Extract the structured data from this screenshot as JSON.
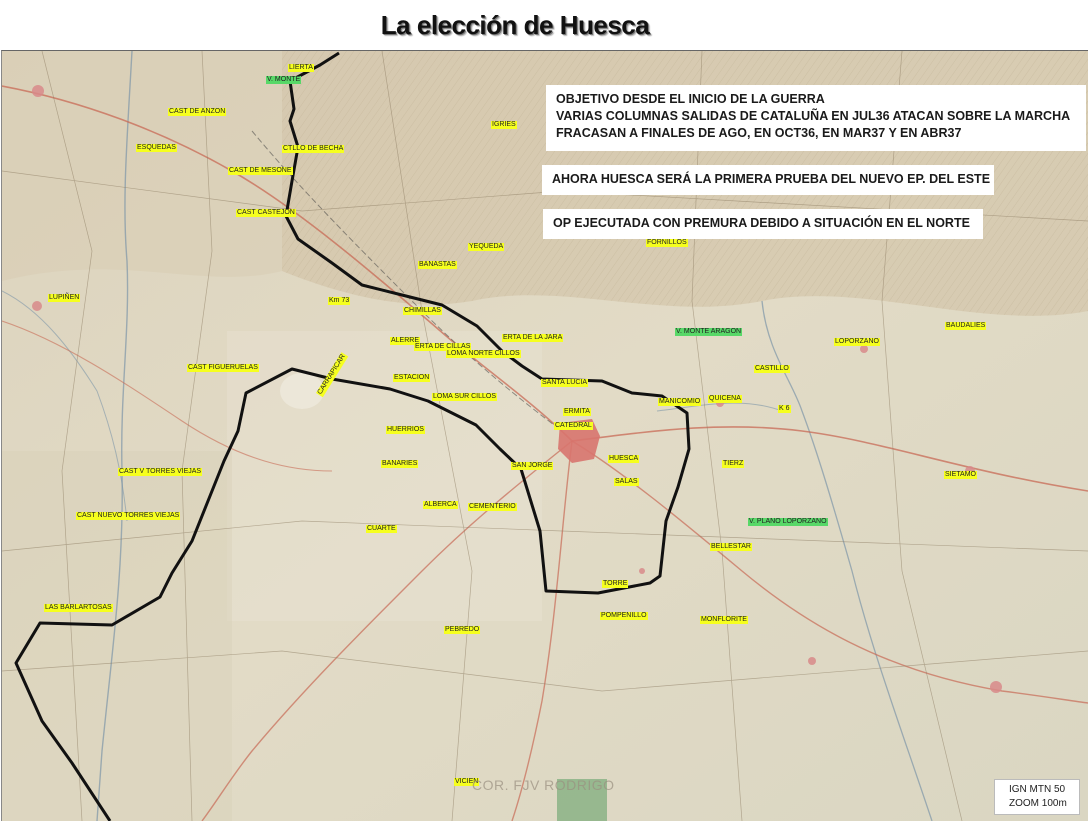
{
  "title": "La elección de Huesca",
  "notes": {
    "objective": [
      "OBJETIVO DESDE EL INICIO DE LA GUERRA",
      "VARIAS COLUMNAS SALIDAS DE CATALUÑA EN JUL36 ATACAN SOBRE LA MARCHA",
      "FRACASAN A FINALES DE AGO, EN OCT36, EN MAR37 Y EN ABR37"
    ],
    "first_test": "AHORA HUESCA SERÁ LA PRIMERA PRUEBA DEL NUEVO EP. DEL ESTE",
    "execution": "OP EJECUTADA CON PREMURA DEBIDO A SITUACIÓN EN EL NORTE"
  },
  "source": {
    "line1": "IGN MTN 50",
    "line2": "ZOOM 100m"
  },
  "watermark": "COR. FJV RODRIGO",
  "places": [
    {
      "label": "LIERTA",
      "type": "yellow"
    },
    {
      "label": "V. MONTE",
      "type": "green"
    },
    {
      "label": "CAST DE ANZON",
      "type": "yellow"
    },
    {
      "label": "IGRIES",
      "type": "yellow"
    },
    {
      "label": "ESQUEDAS",
      "type": "yellow"
    },
    {
      "label": "CTLLO DE BECHA",
      "type": "yellow"
    },
    {
      "label": "CAST DE MESONE",
      "type": "yellow"
    },
    {
      "label": "CAST CASTEJON",
      "type": "yellow"
    },
    {
      "label": "YEQUEDA",
      "type": "yellow"
    },
    {
      "label": "FORNILLOS",
      "type": "yellow"
    },
    {
      "label": "BANASTAS",
      "type": "yellow"
    },
    {
      "label": "LUPIÑEN",
      "type": "yellow"
    },
    {
      "label": "Km 73",
      "type": "yellow"
    },
    {
      "label": "CHIMILLAS",
      "type": "yellow"
    },
    {
      "label": "V. MONTE ARAGON",
      "type": "green"
    },
    {
      "label": "BAUDALIES",
      "type": "yellow"
    },
    {
      "label": "ALERRE",
      "type": "yellow"
    },
    {
      "label": "ERTA DE CILLAS",
      "type": "yellow"
    },
    {
      "label": "ERTA DE LA JARA",
      "type": "yellow"
    },
    {
      "label": "LOPORZANO",
      "type": "yellow"
    },
    {
      "label": "LOMA NORTE CILLOS",
      "type": "yellow"
    },
    {
      "label": "CAST FIGUERUELAS",
      "type": "yellow"
    },
    {
      "label": "CASTILLO",
      "type": "yellow"
    },
    {
      "label": "ESTACION",
      "type": "yellow"
    },
    {
      "label": "SANTA LUCIA",
      "type": "yellow"
    },
    {
      "label": "LOMA SUR CILLOS",
      "type": "yellow"
    },
    {
      "label": "MANICOMIO",
      "type": "yellow"
    },
    {
      "label": "QUICENA",
      "type": "yellow"
    },
    {
      "label": "K 6",
      "type": "yellow"
    },
    {
      "label": "ERMITA",
      "type": "yellow"
    },
    {
      "label": "CATEDRAL",
      "type": "yellow"
    },
    {
      "label": "HUERRIOS",
      "type": "yellow"
    },
    {
      "label": "HUESCA",
      "type": "yellow"
    },
    {
      "label": "BANARIES",
      "type": "yellow"
    },
    {
      "label": "SAN JORGE",
      "type": "yellow"
    },
    {
      "label": "TIERZ",
      "type": "yellow"
    },
    {
      "label": "CAST V TORRES VIEJAS",
      "type": "yellow"
    },
    {
      "label": "SALAS",
      "type": "yellow"
    },
    {
      "label": "SIETAMO",
      "type": "yellow"
    },
    {
      "label": "ALBERCA",
      "type": "yellow"
    },
    {
      "label": "CEMENTERIO",
      "type": "yellow"
    },
    {
      "label": "CAST NUEVO TORRES VIEJAS",
      "type": "yellow"
    },
    {
      "label": "V. PLANO LOPORZANO",
      "type": "green"
    },
    {
      "label": "CUARTE",
      "type": "yellow"
    },
    {
      "label": "BELLESTAR",
      "type": "yellow"
    },
    {
      "label": "TORRE",
      "type": "yellow"
    },
    {
      "label": "LAS BARLARTOSAS",
      "type": "yellow"
    },
    {
      "label": "POMPENILLO",
      "type": "yellow"
    },
    {
      "label": "MONFLORITE",
      "type": "yellow"
    },
    {
      "label": "PEBREDO",
      "type": "yellow"
    },
    {
      "label": "VICIEN",
      "type": "yellow"
    },
    {
      "label": "CARRAPICAR",
      "type": "yellow"
    }
  ]
}
